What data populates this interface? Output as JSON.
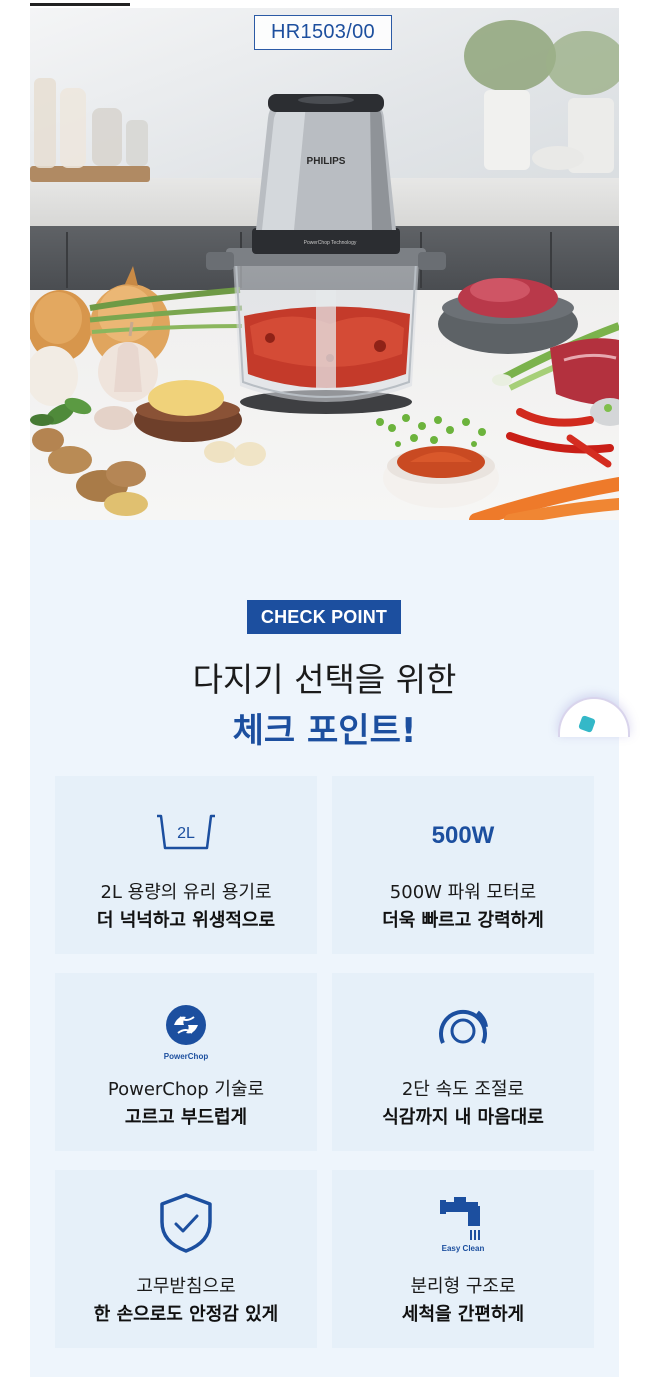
{
  "model_tag": "HR1503/00",
  "hero": {
    "brand_on_product": "PHILIPS",
    "lid_text": "PowerChop Technology"
  },
  "check_point": {
    "badge": "CHECK POINT",
    "title_line1": "다지기 선택을 위한",
    "title_line2": "체크 포인트!"
  },
  "features": [
    {
      "icon": "bowl-2l-icon",
      "icon_text": "2L",
      "line1": "2L 용량의 유리 용기로",
      "line2": "더 넉넉하고 위생적으로"
    },
    {
      "icon": "wattage-text",
      "icon_text": "500W",
      "line1": "500W 파워 모터로",
      "line2": "더욱 빠르고 강력하게"
    },
    {
      "icon": "powerchop-icon",
      "icon_text": "PowerChop",
      "line1": "PowerChop 기술로",
      "line2": "고르고 부드럽게"
    },
    {
      "icon": "speed-dial-icon",
      "icon_text": "",
      "line1": "2단 속도 조절로",
      "line2": "식감까지 내 마음대로"
    },
    {
      "icon": "shield-check-icon",
      "icon_text": "",
      "line1": "고무받침으로",
      "line2": "한 손으로도 안정감 있게"
    },
    {
      "icon": "faucet-icon",
      "icon_text": "Easy Clean",
      "line1": "분리형 구조로",
      "line2": "세척을 간편하게"
    }
  ],
  "colors": {
    "brand_blue": "#1c4f9f",
    "card_bg": "#e6f0f9",
    "section_bg": "#eef5fc"
  }
}
